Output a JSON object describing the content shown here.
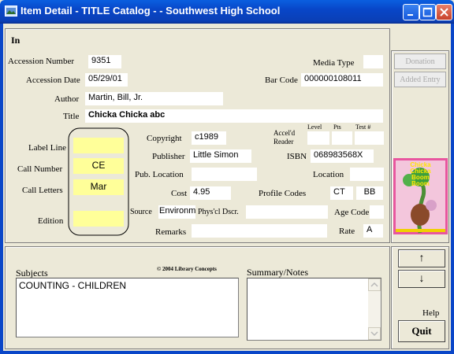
{
  "window": {
    "title": "Item Detail - TITLE Catalog -  - Southwest High School"
  },
  "status": "In",
  "fields": {
    "accession_number": {
      "label": "Accession Number",
      "value": "9351"
    },
    "media_type": {
      "label": "Media Type",
      "value": ""
    },
    "accession_date": {
      "label": "Accession Date",
      "value": "05/29/01"
    },
    "bar_code": {
      "label": "Bar Code",
      "value": "000000108011"
    },
    "author": {
      "label": "Author",
      "value": "Martin, Bill, Jr."
    },
    "title": {
      "label": "Title",
      "value": "Chicka Chicka abc"
    },
    "label_line": {
      "label": "Label Line",
      "value": ""
    },
    "call_number": {
      "label": "Call Number",
      "value": "CE"
    },
    "call_letters": {
      "label": "Call Letters",
      "value": "Mar"
    },
    "edition": {
      "label": "Edition",
      "value": ""
    },
    "copyright": {
      "label": "Copyright",
      "value": "c1989"
    },
    "publisher": {
      "label": "Publisher",
      "value": "Little Simon"
    },
    "pub_location": {
      "label": "Pub. Location",
      "value": ""
    },
    "cost": {
      "label": "Cost",
      "value": "4.95"
    },
    "source": {
      "label": "Source",
      "value": "Environm"
    },
    "phys_descr": {
      "label": "Phys'cl Dscr.",
      "value": ""
    },
    "remarks": {
      "label": "Remarks",
      "value": ""
    },
    "accel_reader": {
      "label": "Accel'd Reader",
      "level_label": "Level",
      "pts_label": "Pts",
      "test_label": "Test #",
      "level": "",
      "pts": "",
      "test": ""
    },
    "isbn": {
      "label": "ISBN",
      "value": "068983568X"
    },
    "location": {
      "label": "Location",
      "value": ""
    },
    "profile_codes": {
      "label": "Profile Codes",
      "value1": "CT",
      "value2": "BB"
    },
    "age_code": {
      "label": "Age Code",
      "value": ""
    },
    "rate": {
      "label": "Rate",
      "value": "A"
    }
  },
  "buttons": {
    "donation": "Donation",
    "added_entry": "Added Entry",
    "up": "↑",
    "down": "↓",
    "help": "Help",
    "quit": "Quit"
  },
  "cover": {
    "title_line1": "Chicka",
    "title_line2": "Chicka",
    "title_line3": "Boom",
    "title_line4": "Boom"
  },
  "subjects": {
    "label": "Subjects",
    "items": [
      "COUNTING - CHILDREN"
    ]
  },
  "copyright_notice": "© 2004 Library Concepts",
  "summary": {
    "label": "Summary/Notes",
    "value": ""
  },
  "colors": {
    "titlebar": "#0a5fe0",
    "field_yellow": "#ffff99",
    "window_bg": "#ece9d8"
  }
}
